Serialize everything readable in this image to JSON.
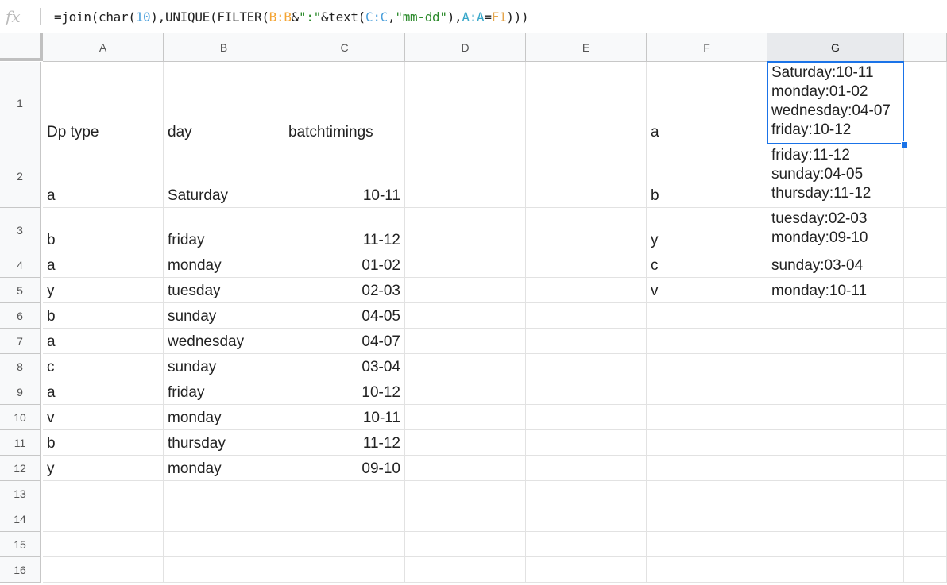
{
  "formula_bar": {
    "fx_icon": "fx-icon",
    "formula_parts": [
      {
        "t": "=join(char(",
        "c": ""
      },
      {
        "t": "10",
        "c": "num"
      },
      {
        "t": "),UNIQUE(FILTER(",
        "c": ""
      },
      {
        "t": "B:B",
        "c": "ref-b"
      },
      {
        "t": "&",
        "c": ""
      },
      {
        "t": "\":\"",
        "c": "str"
      },
      {
        "t": "&text(",
        "c": ""
      },
      {
        "t": "C:C",
        "c": "ref-c"
      },
      {
        "t": ",",
        "c": ""
      },
      {
        "t": "\"mm-dd\"",
        "c": "str"
      },
      {
        "t": "),",
        "c": ""
      },
      {
        "t": "A:A",
        "c": "ref-a"
      },
      {
        "t": "=",
        "c": ""
      },
      {
        "t": "F1",
        "c": "ref-f"
      },
      {
        "t": ")))",
        "c": ""
      }
    ]
  },
  "columns": [
    "A",
    "B",
    "C",
    "D",
    "E",
    "F",
    "G"
  ],
  "selected_column": "G",
  "rows": [
    "1",
    "2",
    "3",
    "4",
    "5",
    "6",
    "7",
    "8",
    "9",
    "10",
    "11",
    "12",
    "13",
    "14",
    "15",
    "16"
  ],
  "cells": {
    "A1": "Dp type",
    "B1": "day",
    "C1": "batchtimings",
    "F1": "a",
    "G1": "Saturday:10-11\nmonday:01-02\nwednesday:04-07\nfriday:10-12",
    "A2": "a",
    "B2": "Saturday",
    "C2": "10-11",
    "F2": "b",
    "G2": "friday:11-12\nsunday:04-05\nthursday:11-12",
    "A3": "b",
    "B3": "friday",
    "C3": "11-12",
    "F3": "y",
    "G3": "tuesday:02-03\nmonday:09-10",
    "A4": "a",
    "B4": "monday",
    "C4": "01-02",
    "F4": "c",
    "G4": "sunday:03-04",
    "A5": "y",
    "B5": "tuesday",
    "C5": "02-03",
    "F5": "v",
    "G5": "monday:10-11",
    "A6": "b",
    "B6": "sunday",
    "C6": "04-05",
    "A7": "a",
    "B7": "wednesday",
    "C7": "04-07",
    "A8": "c",
    "B8": "sunday",
    "C8": "03-04",
    "A9": "a",
    "B9": "friday",
    "C9": "10-12",
    "A10": "v",
    "B10": "monday",
    "C10": "10-11",
    "A11": "b",
    "B11": "thursday",
    "C11": "11-12",
    "A12": "y",
    "B12": "monday",
    "C12": "09-10"
  },
  "selected_cell": "G1",
  "colors": {
    "selection": "#1a73e8",
    "header_bg": "#f8f9fa"
  }
}
